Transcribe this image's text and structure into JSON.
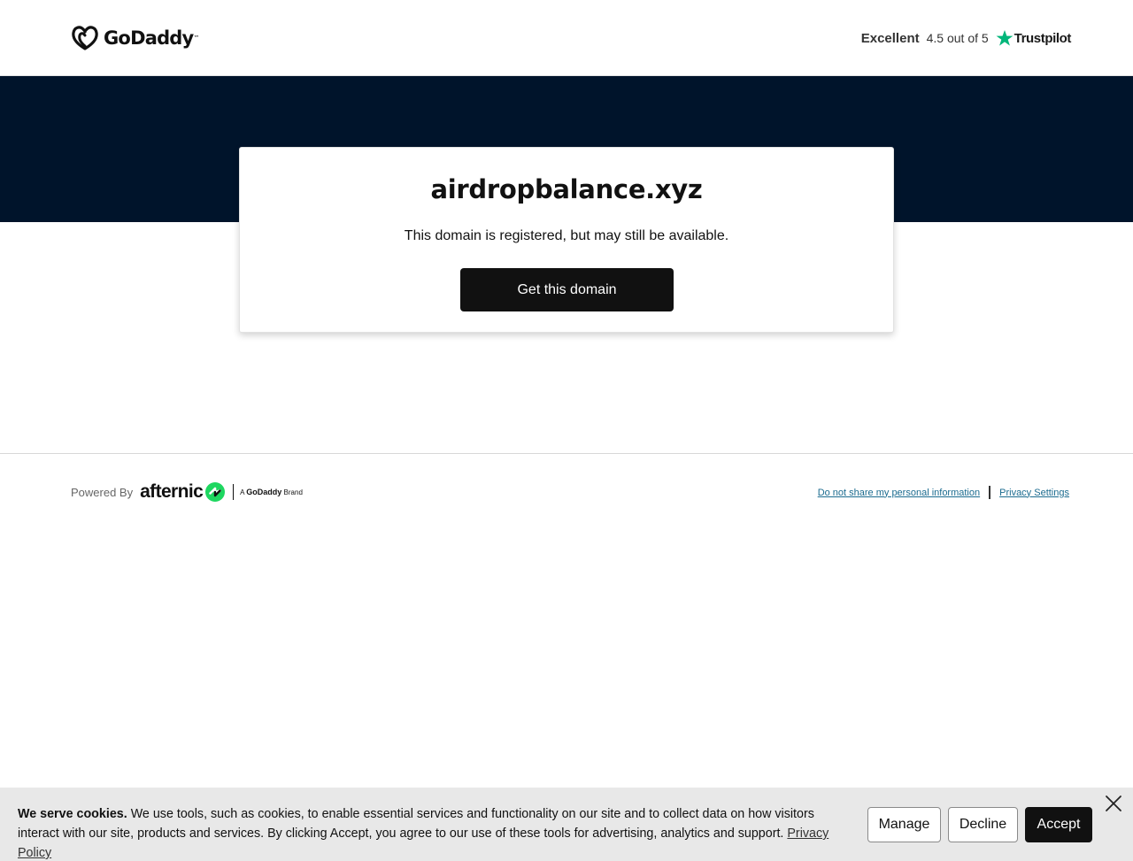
{
  "header": {
    "logo_text": "GoDaddy",
    "rating_word": "Excellent",
    "rating_score": "4.5 out of 5",
    "trustpilot_label": "Trustpilot",
    "trustpilot_star_color": "#00b67a"
  },
  "hero": {
    "background_color": "#00142b",
    "domain_name": "airdropbalance.xyz",
    "subtitle": "This domain is registered, but may still be available.",
    "cta_label": "Get this domain"
  },
  "footer": {
    "powered_by_label": "Powered By",
    "afternic_word": "afternic",
    "afternic_mark_color": "#1ed760",
    "brand_tag_prefix": "A",
    "brand_tag_name": "GoDaddy",
    "brand_tag_suffix": "Brand",
    "links": [
      {
        "label": "Do not share my personal information"
      },
      {
        "label": "Privacy Settings"
      }
    ]
  },
  "cookie_banner": {
    "heading": "We serve cookies.",
    "body": " We use tools, such as cookies, to enable essential services and functionality on our site and to collect data on how visitors interact with our site, products and services. By clicking Accept, you agree to our use of these tools for advertising, analytics and support. ",
    "policy_link": "Privacy Policy",
    "buttons": {
      "manage": "Manage",
      "decline": "Decline",
      "accept": "Accept"
    },
    "close_icon": "close-icon"
  }
}
